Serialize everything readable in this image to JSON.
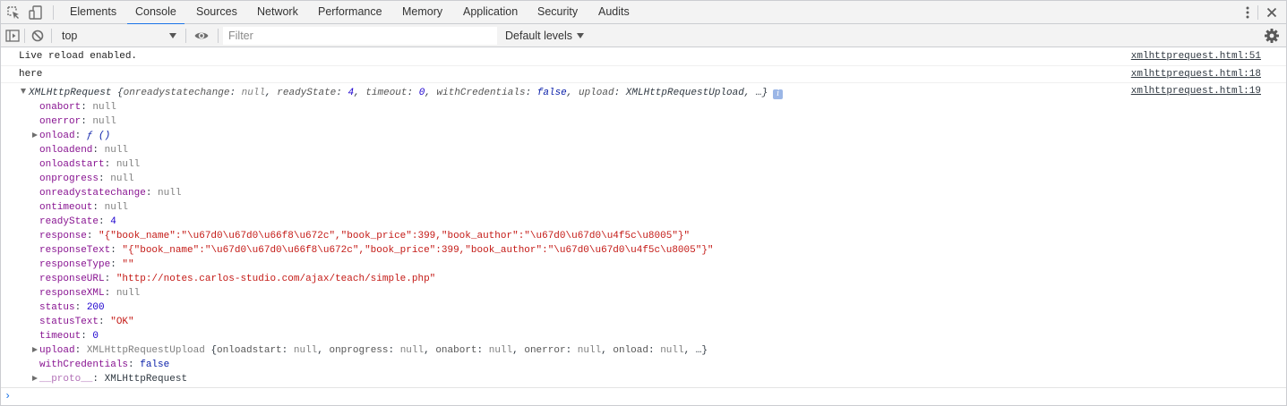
{
  "tabs": [
    {
      "label": "Elements"
    },
    {
      "label": "Console",
      "selected": true
    },
    {
      "label": "Sources"
    },
    {
      "label": "Network"
    },
    {
      "label": "Performance"
    },
    {
      "label": "Memory"
    },
    {
      "label": "Application"
    },
    {
      "label": "Security"
    },
    {
      "label": "Audits"
    }
  ],
  "toolbar": {
    "context": "top",
    "filter_placeholder": "Filter",
    "filter_value": "",
    "levels_label": "Default levels"
  },
  "icons": {
    "inspect": "inspect-element-icon",
    "device": "device-toolbar-icon",
    "sidebar": "show-sidebar-icon",
    "clear": "clear-console-icon",
    "eye": "live-expression-icon",
    "kebab": "more-options-icon",
    "close": "close-icon",
    "gear": "settings-icon",
    "prompt": "prompt-chevron-icon"
  },
  "accent_color": "#1a73e8",
  "messages": [
    {
      "text": "Live reload enabled.",
      "source": "xmlhttprequest.html:51"
    },
    {
      "text": "here",
      "source": "xmlhttprequest.html:18"
    },
    {
      "source": "xmlhttprequest.html:19"
    }
  ],
  "xhr": {
    "class_name": "XMLHttpRequest",
    "summary": {
      "k1": "onreadystatechange",
      "v1": "null",
      "k2": "readyState",
      "v2": "4",
      "k3": "timeout",
      "v3": "0",
      "k4": "withCredentials",
      "v4": "false",
      "k5": "upload",
      "v5": "XMLHttpRequestUpload",
      "ellipsis": "…"
    },
    "info_badge": "i",
    "props": {
      "onabort": "null",
      "onerror": "null",
      "onload": "ƒ ()",
      "onloadend": "null",
      "onloadstart": "null",
      "onprogress": "null",
      "onreadystatechange": "null",
      "ontimeout": "null",
      "readyState": "4",
      "response": "\"{\"book_name\":\"\\u67d0\\u67d0\\u66f8\\u672c\",\"book_price\":399,\"book_author\":\"\\u67d0\\u67d0\\u4f5c\\u8005\"}\"",
      "responseText": "\"{\"book_name\":\"\\u67d0\\u67d0\\u66f8\\u672c\",\"book_price\":399,\"book_author\":\"\\u67d0\\u67d0\\u4f5c\\u8005\"}\"",
      "responseType": "\"\"",
      "responseURL": "\"http://notes.carlos-studio.com/ajax/teach/simple.php\"",
      "responseXML": "null",
      "status": "200",
      "statusText": "\"OK\"",
      "timeout": "0",
      "upload_class": "XMLHttpRequestUpload",
      "upload_summary": {
        "k1": "onloadstart",
        "v1": "null",
        "k2": "onprogress",
        "v2": "null",
        "k3": "onabort",
        "v3": "null",
        "k4": "onerror",
        "v4": "null",
        "k5": "onload",
        "v5": "null",
        "ellipsis": "…"
      },
      "withCredentials": "false",
      "proto_key": "__proto__",
      "proto_val": "XMLHttpRequest"
    }
  },
  "prompt_glyph": "›"
}
